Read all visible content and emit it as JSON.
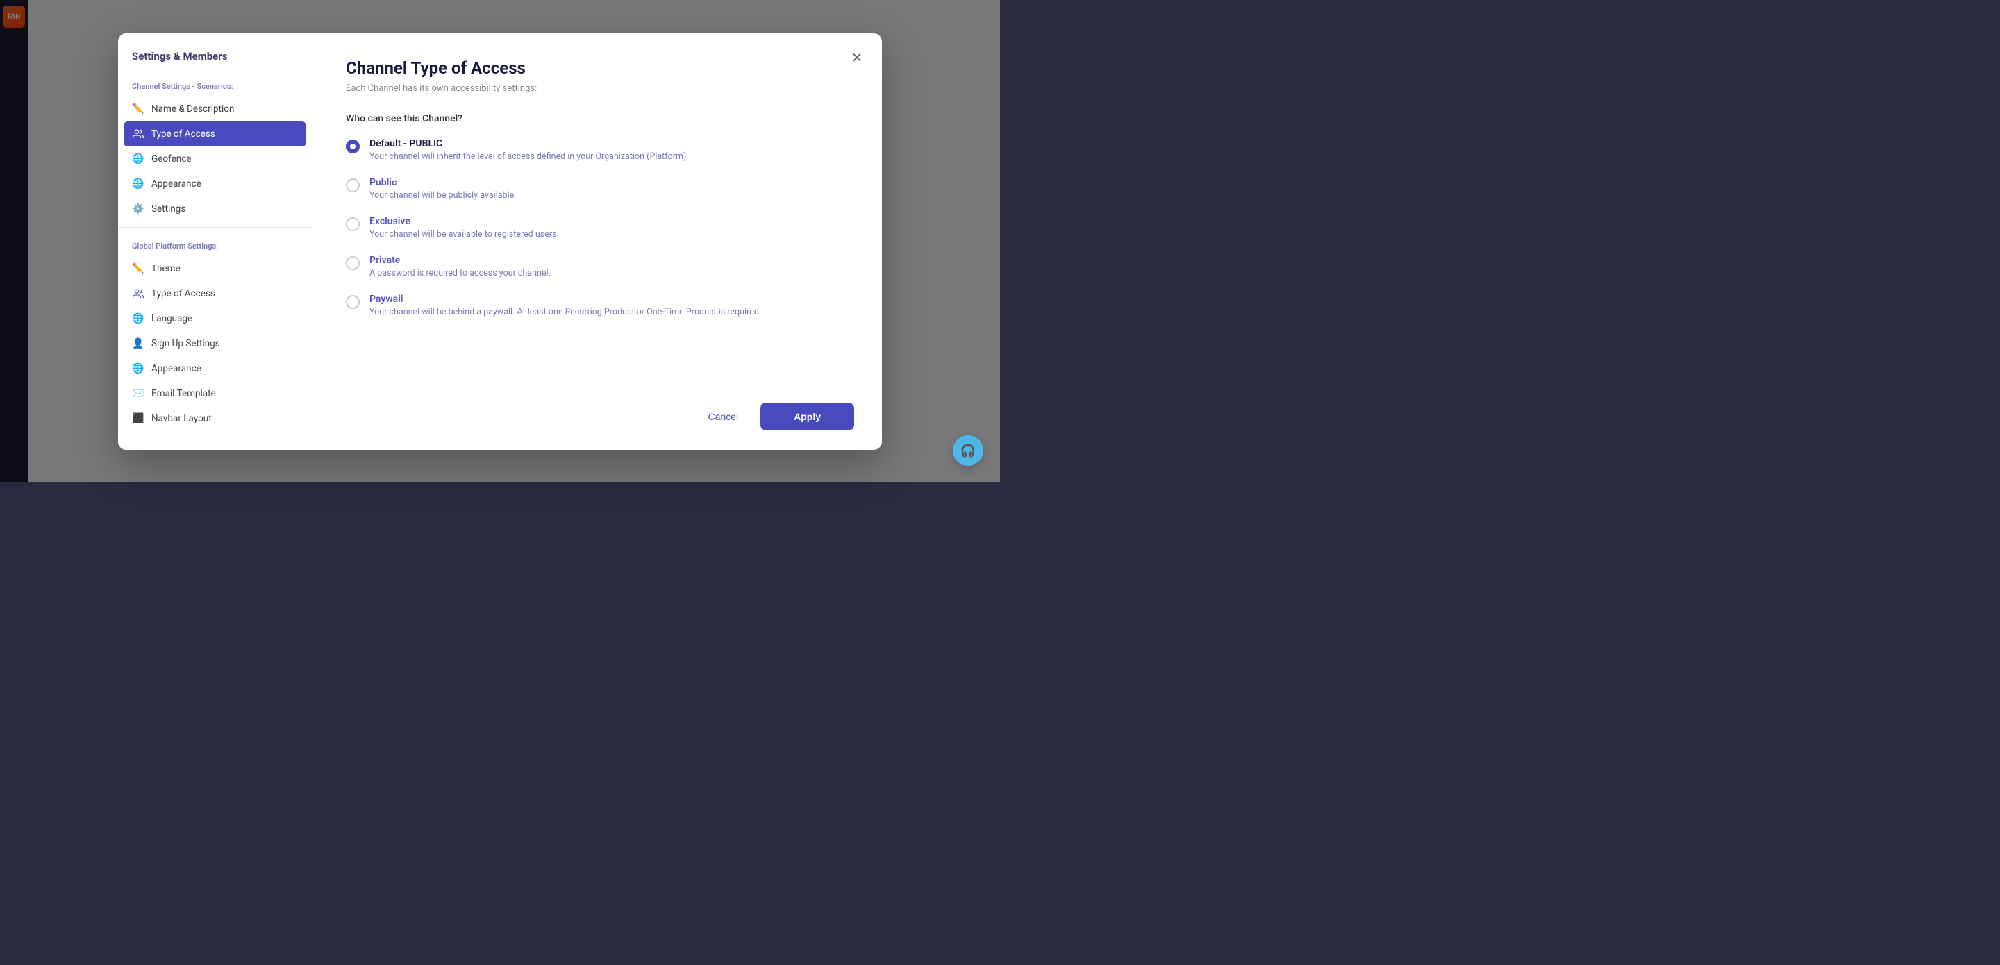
{
  "sidebar": {
    "title": "Settings & Members",
    "channel_section_label": "Channel Settings - Scenarios:",
    "channel_items": [
      {
        "id": "name-description",
        "label": "Name & Description",
        "icon": "pencil"
      },
      {
        "id": "type-of-access",
        "label": "Type of Access",
        "icon": "users",
        "active": true
      },
      {
        "id": "geofence",
        "label": "Geofence",
        "icon": "globe"
      },
      {
        "id": "appearance",
        "label": "Appearance",
        "icon": "globe-alt"
      },
      {
        "id": "settings",
        "label": "Settings",
        "icon": "gear"
      }
    ],
    "global_section_label": "Global Platform Settings:",
    "global_items": [
      {
        "id": "theme",
        "label": "Theme",
        "icon": "pencil"
      },
      {
        "id": "type-of-access-global",
        "label": "Type of Access",
        "icon": "users"
      },
      {
        "id": "language",
        "label": "Language",
        "icon": "globe"
      },
      {
        "id": "sign-up-settings",
        "label": "Sign Up Settings",
        "icon": "user"
      },
      {
        "id": "appearance-global",
        "label": "Appearance",
        "icon": "globe-alt"
      },
      {
        "id": "email-template",
        "label": "Email Template",
        "icon": "envelope"
      },
      {
        "id": "navbar-layout",
        "label": "Navbar Layout",
        "icon": "layout"
      }
    ]
  },
  "modal": {
    "title": "Channel Type of Access",
    "subtitle": "Each Channel has its own accessibility settings:",
    "question": "Who can see this Channel?",
    "options": [
      {
        "id": "default-public",
        "label": "Default - PUBLIC",
        "description": "Your channel will inherit the level of access defined in your Organization (Platform).",
        "selected": true
      },
      {
        "id": "public",
        "label": "Public",
        "description": "Your channel will be publicly available.",
        "selected": false
      },
      {
        "id": "exclusive",
        "label": "Exclusive",
        "description": "Your channel will be available to registered users.",
        "selected": false
      },
      {
        "id": "private",
        "label": "Private",
        "description": "A password is required to access your channel.",
        "selected": false
      },
      {
        "id": "paywall",
        "label": "Paywall",
        "description": "Your channel will be behind a paywall. At least one Recurring Product or One-Time Product is required.",
        "selected": false
      }
    ],
    "cancel_label": "Cancel",
    "apply_label": "Apply"
  }
}
